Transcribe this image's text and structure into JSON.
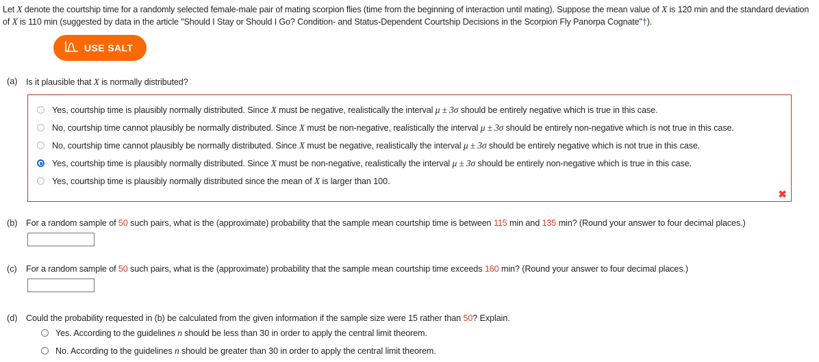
{
  "problem": {
    "intro_pre": "Let ",
    "intro_var1": "X",
    "intro_mid1": " denote the courtship time for a randomly selected female-male pair of mating scorpion flies (time from the beginning of interaction until mating). Suppose the mean value of ",
    "intro_var2": "X",
    "intro_mid2": " is 120 min and the standard deviation of ",
    "intro_var3": "X",
    "intro_mid3": " is 110 min (suggested by data in the article \"Should I Stay or Should I Go? Condition- and Status-Dependent Courtship Decisions in the Scorpion Fly Panorpa Cognate\"",
    "intro_dagger": "†",
    "intro_end": ")."
  },
  "salt": {
    "label": "USE SALT",
    "icon": "normal-curve-icon",
    "color": "#f96a07"
  },
  "parts": {
    "a": {
      "label": "(a)",
      "text_pre": "Is it plausible that ",
      "text_var": "X",
      "text_post": " is normally distributed?",
      "options": [
        {
          "id": "a1",
          "selected": false,
          "pre": "Yes, courtship time is plausibly normally distributed. Since ",
          "var": "X",
          "mid": " must be negative, realistically the interval ",
          "formula": "μ ± 3σ",
          "post": " should be entirely negative which is true in this case."
        },
        {
          "id": "a2",
          "selected": false,
          "pre": "No, courtship time cannot plausibly be normally distributed. Since ",
          "var": "X",
          "mid": " must be non-negative, realistically the interval ",
          "formula": "μ ± 3σ",
          "post": " should be entirely non-negative which is not true in this case."
        },
        {
          "id": "a3",
          "selected": false,
          "pre": "No, courtship time cannot plausibly be normally distributed. Since ",
          "var": "X",
          "mid": " must be negative, realistically the interval ",
          "formula": "μ ± 3σ",
          "post": " should be entirely negative which is not true in this case."
        },
        {
          "id": "a4",
          "selected": true,
          "pre": "Yes, courtship time is plausibly normally distributed. Since ",
          "var": "X",
          "mid": " must be non-negative, realistically the interval ",
          "formula": "μ ± 3σ",
          "post": " should be entirely non-negative which is true in this case."
        },
        {
          "id": "a5",
          "selected": false,
          "pre": "Yes, courtship time is plausibly normally distributed since the mean of ",
          "var": "X",
          "mid": " is larger than 100.",
          "formula": "",
          "post": ""
        }
      ],
      "feedback_icon": "incorrect-x-icon",
      "feedback_color": "#e8423a"
    },
    "b": {
      "label": "(b)",
      "t1": "For a random sample of ",
      "n": "50",
      "t2": " such pairs, what is the (approximate) probability that the sample mean courtship time is between ",
      "low": "115",
      "t3": " min and ",
      "high": "135",
      "t4": " min? (Round your answer to four decimal places.)",
      "answer_value": ""
    },
    "c": {
      "label": "(c)",
      "t1": "For a random sample of ",
      "n": "50",
      "t2": " such pairs, what is the (approximate) probability that the sample mean courtship time exceeds ",
      "threshold": "160",
      "t3": " min? (Round your answer to four decimal places.)",
      "answer_value": ""
    },
    "d": {
      "label": "(d)",
      "t1": "Could the probability requested in (b) be calculated from the given information if the sample size were 15 rather than ",
      "n": "50",
      "t2": "? Explain.",
      "options": [
        {
          "id": "d1",
          "selected": false,
          "pre": "Yes. According to the guidelines ",
          "var": "n",
          "post": " should be less than 30 in order to apply the central limit theorem."
        },
        {
          "id": "d2",
          "selected": false,
          "pre": "No. According to the guidelines ",
          "var": "n",
          "post": " should be greater than 30 in order to apply the central limit theorem."
        }
      ]
    }
  }
}
